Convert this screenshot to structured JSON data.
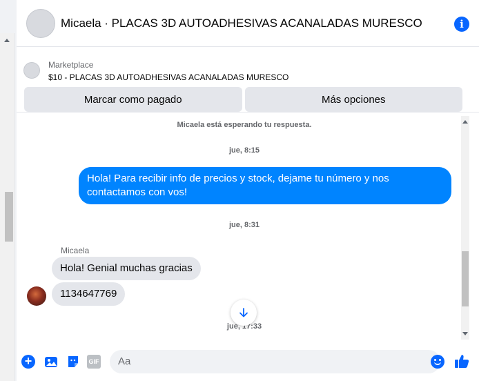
{
  "header": {
    "title": "Micaela · PLACAS 3D AUTOADHESIVAS ACANALADAS MURESCO"
  },
  "marketplace": {
    "label": "Marketplace",
    "product": "$10 - PLACAS 3D AUTOADHESIVAS ACANALADAS MURESCO"
  },
  "actions": {
    "mark_paid": "Marcar como pagado",
    "more_options": "Más opciones"
  },
  "chat": {
    "waiting": "Micaela está esperando tu respuesta.",
    "time1": "jue, 8:15",
    "outgoing": "Hola! Para recibir info de precios y stock, dejame tu número y nos contactamos con vos!",
    "time2": "jue, 8:31",
    "sender": "Micaela",
    "incoming1": "Hola! Genial muchas gracias",
    "incoming2": "1134647769",
    "time3": "jue, 17:33"
  },
  "composer": {
    "placeholder": "Aa",
    "gif_label": "GIF"
  },
  "colors": {
    "accent": "#0866ff",
    "outgoing_bubble": "#0084ff",
    "incoming_bubble": "#e4e6eb"
  },
  "icons": [
    "info-icon",
    "plus-icon",
    "photo-icon",
    "sticker-icon",
    "gif-icon",
    "emoji-icon",
    "like-icon",
    "arrow-down-icon"
  ]
}
